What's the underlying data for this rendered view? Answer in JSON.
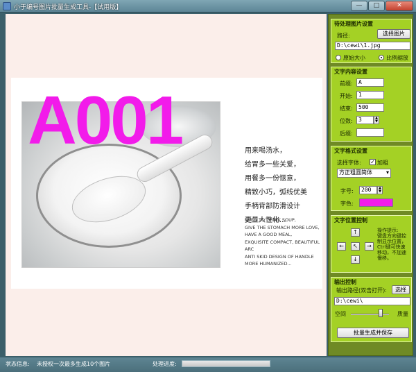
{
  "window": {
    "title": "小于编号图片批量生成工具-【试用版】",
    "minimize_label": "—",
    "maximize_label": "□",
    "close_label": "✕"
  },
  "preview": {
    "watermark_text": "A001",
    "watermark_color": "#f21bea",
    "cn_lines": [
      "用来喝汤水，",
      "给胃多一些关爱，",
      "用餐多一份惬意，",
      "精致小巧，弧线优美",
      "手柄背部防滑设计",
      "更显人性化..."
    ],
    "en_lines": [
      "USED TO DRINK SOUP,",
      "GIVE THE STOMACH MORE LOVE,",
      "HAVE A GOOD MEAL,",
      "EXQUISITE COMPACT, BEAUTIFUL ARC",
      "ANTI SKID DESIGN OF HANDLE",
      "MORE HUMANIZED..."
    ]
  },
  "image_settings": {
    "title": "待处理图片设置",
    "path_label": "路径:",
    "choose_button": "选择图片",
    "path_value": "D:\\cewi\\1.jpg",
    "radio_original": "原始大小",
    "radio_scale": "比例缩放",
    "selected": "scale"
  },
  "text_settings": {
    "title": "文字内容设置",
    "rows": [
      {
        "label": "前缀:",
        "value": "A"
      },
      {
        "label": "开始:",
        "value": "1"
      },
      {
        "label": "结束:",
        "value": "500"
      },
      {
        "label": "位数:",
        "value": "3"
      },
      {
        "label": "后缀:",
        "value": ""
      }
    ]
  },
  "format_settings": {
    "title": "文字格式设置",
    "font_label": "选择字体:",
    "bold_label": "加粗",
    "bold_checked": true,
    "font_value": "方正粗圆简体",
    "size_label": "字号:",
    "size_value": "200",
    "color_label": "字色:",
    "color_value": "#f21bea"
  },
  "position_control": {
    "title": "文字位置控制",
    "hint": [
      "操作提示:",
      "键盘方向键控",
      "制显示位置，",
      "Ctrl键可快速",
      "移动，不加速",
      "慢移。"
    ],
    "up": "↑",
    "left": "←",
    "center": "↖",
    "right": "→",
    "down": "↓"
  },
  "output_control": {
    "title": "输出控制",
    "path_label": "输出路径(双击打开):",
    "choose_button": "选择",
    "path_value": "D:\\cewi\\",
    "space_label": "空间",
    "quality_label": "质量",
    "quality_level": 0.78,
    "generate_button": "批量生成并保存"
  },
  "status": {
    "label": "状态信息:",
    "message": "未授权一次最多生成10个图片",
    "progress_label": "处理进度:",
    "progress_value": 0
  }
}
